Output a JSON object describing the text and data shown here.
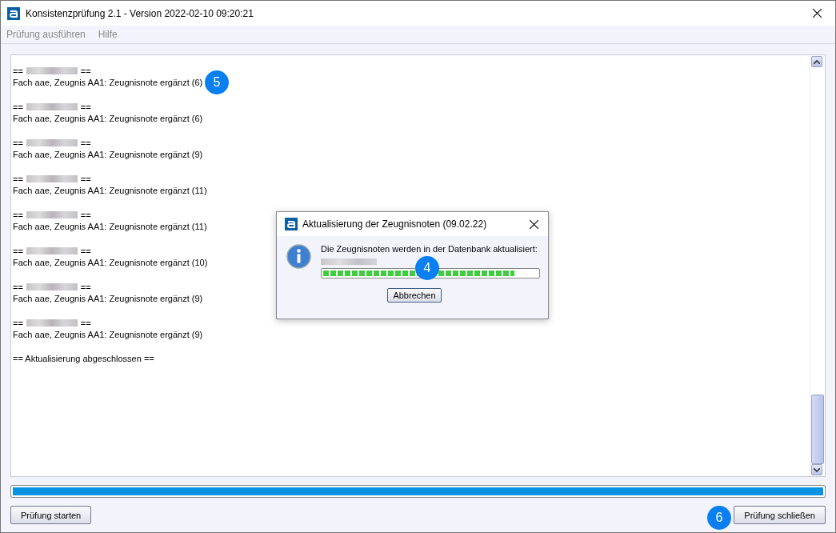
{
  "window": {
    "title": "Konsistenzprüfung 2.1 - Version 2022-02-10 09:20:21"
  },
  "menu": [
    "Prüfung ausführen",
    "Hilfe"
  ],
  "log": {
    "entries": [
      {
        "heading_mark": "==",
        "message": "Fach aae, Zeugnis AA1: Zeugnisnote ergänzt (6)"
      },
      {
        "heading_mark": "==",
        "message": "Fach aae, Zeugnis AA1: Zeugnisnote ergänzt (6)"
      },
      {
        "heading_mark": "==",
        "message": "Fach aae, Zeugnis AA1: Zeugnisnote ergänzt (9)"
      },
      {
        "heading_mark": "==",
        "message": "Fach aae, Zeugnis AA1: Zeugnisnote ergänzt (11)"
      },
      {
        "heading_mark": "==",
        "message": "Fach aae, Zeugnis AA1: Zeugnisnote ergänzt (11)"
      },
      {
        "heading_mark": "==",
        "message": "Fach aae, Zeugnis AA1: Zeugnisnote ergänzt (10)"
      },
      {
        "heading_mark": "==",
        "message": "Fach aae, Zeugnis AA1: Zeugnisnote ergänzt (9)"
      },
      {
        "heading_mark": "==",
        "message": "Fach aae, Zeugnis AA1: Zeugnisnote ergänzt (9)"
      }
    ],
    "footer": "== Aktualisierung abgeschlossen =="
  },
  "progress": {
    "level": 1
  },
  "buttons": {
    "start": "Prüfung starten",
    "close": "Prüfung schließen"
  },
  "dialog": {
    "title": "Aktualisierung der Zeugnisnoten (09.02.22)",
    "message": "Die Zeugnisnoten werden in der Datenbank aktualisiert:",
    "progress": {
      "level": 0.89
    },
    "cancel": "Abbrechen"
  },
  "callouts": [
    {
      "label": "5"
    },
    {
      "label": "4"
    },
    {
      "label": "6"
    }
  ]
}
